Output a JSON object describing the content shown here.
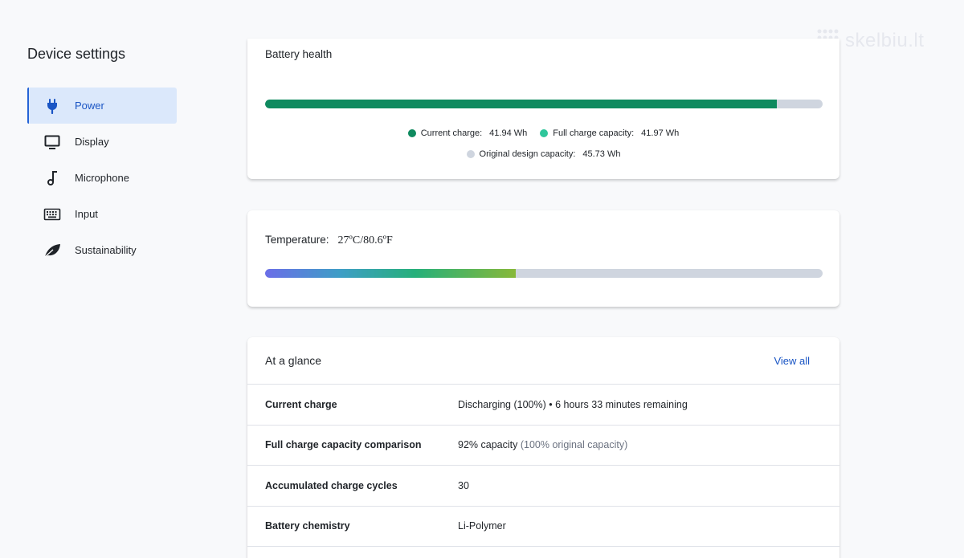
{
  "watermark": {
    "text": "skelbiu.lt",
    "icon": "waffle-logo-icon"
  },
  "sidebar": {
    "title": "Device settings",
    "items": [
      {
        "label": "Power",
        "icon": "plug-icon",
        "active": true
      },
      {
        "label": "Display",
        "icon": "monitor-icon",
        "active": false
      },
      {
        "label": "Microphone",
        "icon": "music-note-icon",
        "active": false
      },
      {
        "label": "Input",
        "icon": "keyboard-icon",
        "active": false
      },
      {
        "label": "Sustainability",
        "icon": "leaf-icon",
        "active": false
      }
    ]
  },
  "battery_health": {
    "title": "Battery health",
    "fill_ratio": 0.918,
    "legend": [
      {
        "label": "Current charge:",
        "value": "41.94 Wh",
        "color": "#0f8a5f"
      },
      {
        "label": "Full charge capacity:",
        "value": "41.97 Wh",
        "color": "#2fc69b"
      },
      {
        "label": "Original design capacity:",
        "value": "45.73 Wh",
        "color": "#cfd5df"
      }
    ]
  },
  "temperature": {
    "label": "Temperature:",
    "value": "27ºC/80.6ºF",
    "fill_ratio": 0.45
  },
  "glance": {
    "title": "At a glance",
    "view_all": "View all",
    "rows": [
      {
        "label": "Current charge",
        "value": "Discharging (100%) • 6 hours 33 minutes remaining",
        "sub": ""
      },
      {
        "label": "Full charge capacity comparison",
        "value": "92% capacity",
        "sub": " (100% original capacity)"
      },
      {
        "label": "Accumulated charge cycles",
        "value": "30",
        "sub": ""
      },
      {
        "label": "Battery chemistry",
        "value": "Li-Polymer",
        "sub": ""
      }
    ]
  }
}
